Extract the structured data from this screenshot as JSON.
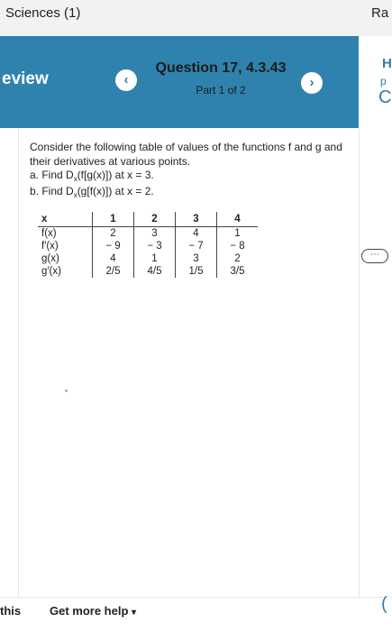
{
  "topbar": {
    "course": "Sciences (1)",
    "right_text": "Ra"
  },
  "header": {
    "left_label": "eview",
    "question_title": "Question 17, 4.3.43",
    "part": "Part 1 of 2",
    "prev_glyph": "‹",
    "next_glyph": "›",
    "right_h": "H",
    "right_p": "p",
    "right_c": "C"
  },
  "problem": {
    "prompt": "Consider the following table of values of the functions f and g and their derivatives at various points.",
    "a": {
      "prefix": "a. Find D",
      "sub": "x",
      "suffix": "(f[g(x)]) at x = 3."
    },
    "b": {
      "prefix": "b. Find D",
      "sub": "x",
      "suffix": "(g[f(x)]) at x = 2."
    }
  },
  "table": {
    "header": [
      "x",
      "1",
      "2",
      "3",
      "4"
    ],
    "rows": [
      [
        "f(x)",
        "2",
        "3",
        "4",
        "1"
      ],
      [
        "f′(x)",
        "− 9",
        "− 3",
        "− 7",
        "− 8"
      ],
      [
        "g(x)",
        "4",
        "1",
        "3",
        "2"
      ],
      [
        "g′(x)",
        "2/5",
        "4/5",
        "1/5",
        "3/5"
      ]
    ]
  },
  "scroll_handle": "⋯",
  "footer": {
    "left": "this",
    "help": "Get more help",
    "caret": "▾",
    "right_glyph": "("
  }
}
